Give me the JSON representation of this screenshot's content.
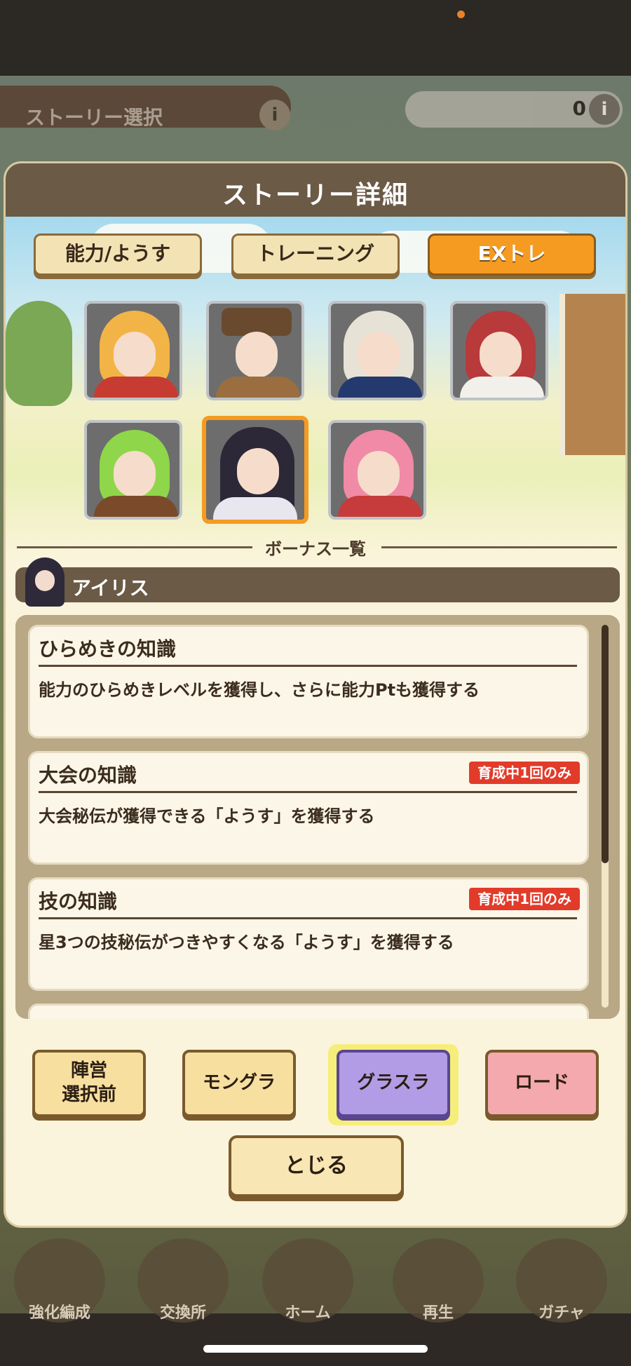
{
  "background": {
    "title": "ストーリー選択",
    "info_icon": "i",
    "currency_value": "0",
    "nav": [
      "強化編成",
      "交換所",
      "ホーム",
      "再生",
      "ガチャ"
    ]
  },
  "modal": {
    "title": "ストーリー詳細",
    "tabs": [
      {
        "label": "能力/ようす",
        "active": false
      },
      {
        "label": "トレーニング",
        "active": false
      },
      {
        "label": "EXトレ",
        "active": true
      }
    ],
    "bonus_list_title": "ボーナス一覧",
    "character_name": "アイリス",
    "bonuses": [
      {
        "title": "ひらめきの知識",
        "badge": "",
        "description": "能力のひらめきレベルを獲得し、さらに能力Ptも獲得する"
      },
      {
        "title": "大会の知識",
        "badge": "育成中1回のみ",
        "description": "大会秘伝が獲得できる「ようす」を獲得する"
      },
      {
        "title": "技の知識",
        "badge": "育成中1回のみ",
        "description": "星3つの技秘伝がつきやすくなる「ようす」を獲得する"
      }
    ],
    "bottom_buttons": [
      {
        "label": "陣営\n選択前",
        "style": "normal"
      },
      {
        "label": "モングラ",
        "style": "normal"
      },
      {
        "label": "グラスラ",
        "style": "purple"
      },
      {
        "label": "ロード",
        "style": "pink"
      }
    ],
    "close_label": "とじる"
  },
  "colors": {
    "accent": "#f59b22",
    "header": "#6b5a46",
    "badge": "#e23b2a"
  }
}
